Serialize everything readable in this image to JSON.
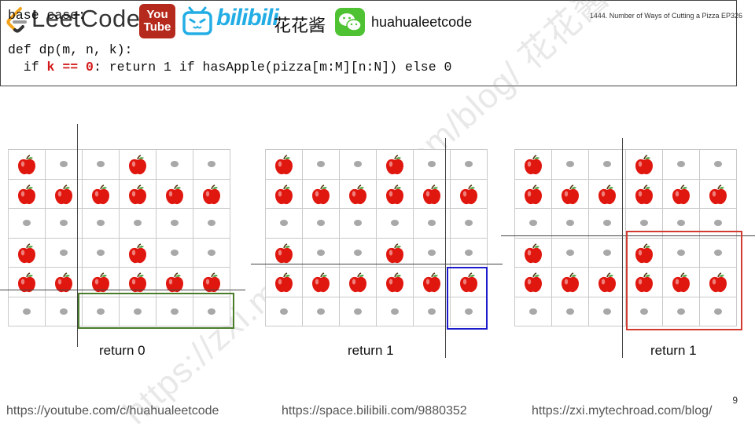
{
  "header": {
    "brand": "LeetCode",
    "youtube_line1": "You",
    "youtube_line2": "Tube",
    "bilibili": "bilibili",
    "chinese_name": "花花酱",
    "handle": "huahualeetcode",
    "episode": "1444. Number of Ways of Cutting a Pizza EP326"
  },
  "code": {
    "line1": "base case:",
    "line2": "def dp(m, n, k):",
    "line3_pre": "  if ",
    "line3_red": "k == 0",
    "line3_post": ": return 1 if hasApple(pizza[m:M][n:N]) else 0"
  },
  "pizza": [
    [
      1,
      0,
      0,
      1,
      0,
      0
    ],
    [
      1,
      1,
      1,
      1,
      1,
      1
    ],
    [
      0,
      0,
      0,
      0,
      0,
      0
    ],
    [
      1,
      0,
      0,
      1,
      0,
      0
    ],
    [
      1,
      1,
      1,
      1,
      1,
      1
    ],
    [
      0,
      0,
      0,
      0,
      0,
      0
    ]
  ],
  "colors": {
    "green": "#4a7d2a",
    "blue": "#1c1ccc",
    "red": "#d23b30",
    "apple": "#e0170f"
  },
  "panels": [
    {
      "label": "return 0",
      "highlight_color": "green",
      "highlight_rows": [
        5,
        5
      ],
      "highlight_cols": [
        2,
        5
      ]
    },
    {
      "label": "return 1",
      "highlight_color": "blue",
      "highlight_rows": [
        4,
        5
      ],
      "highlight_cols": [
        5,
        5
      ]
    },
    {
      "label": "return 1",
      "highlight_color": "red",
      "highlight_rows": [
        3,
        5
      ],
      "highlight_cols": [
        3,
        5
      ]
    }
  ],
  "watermark": "https://zxi.mytechroad.com/blog/ 花花酱 LeetCode",
  "footer": {
    "youtube": "https://youtube.com/c/huahualeetcode",
    "bilibili": "https://space.bilibili.com/9880352",
    "blog": "https://zxi.mytechroad.com/blog/",
    "page": "9"
  }
}
